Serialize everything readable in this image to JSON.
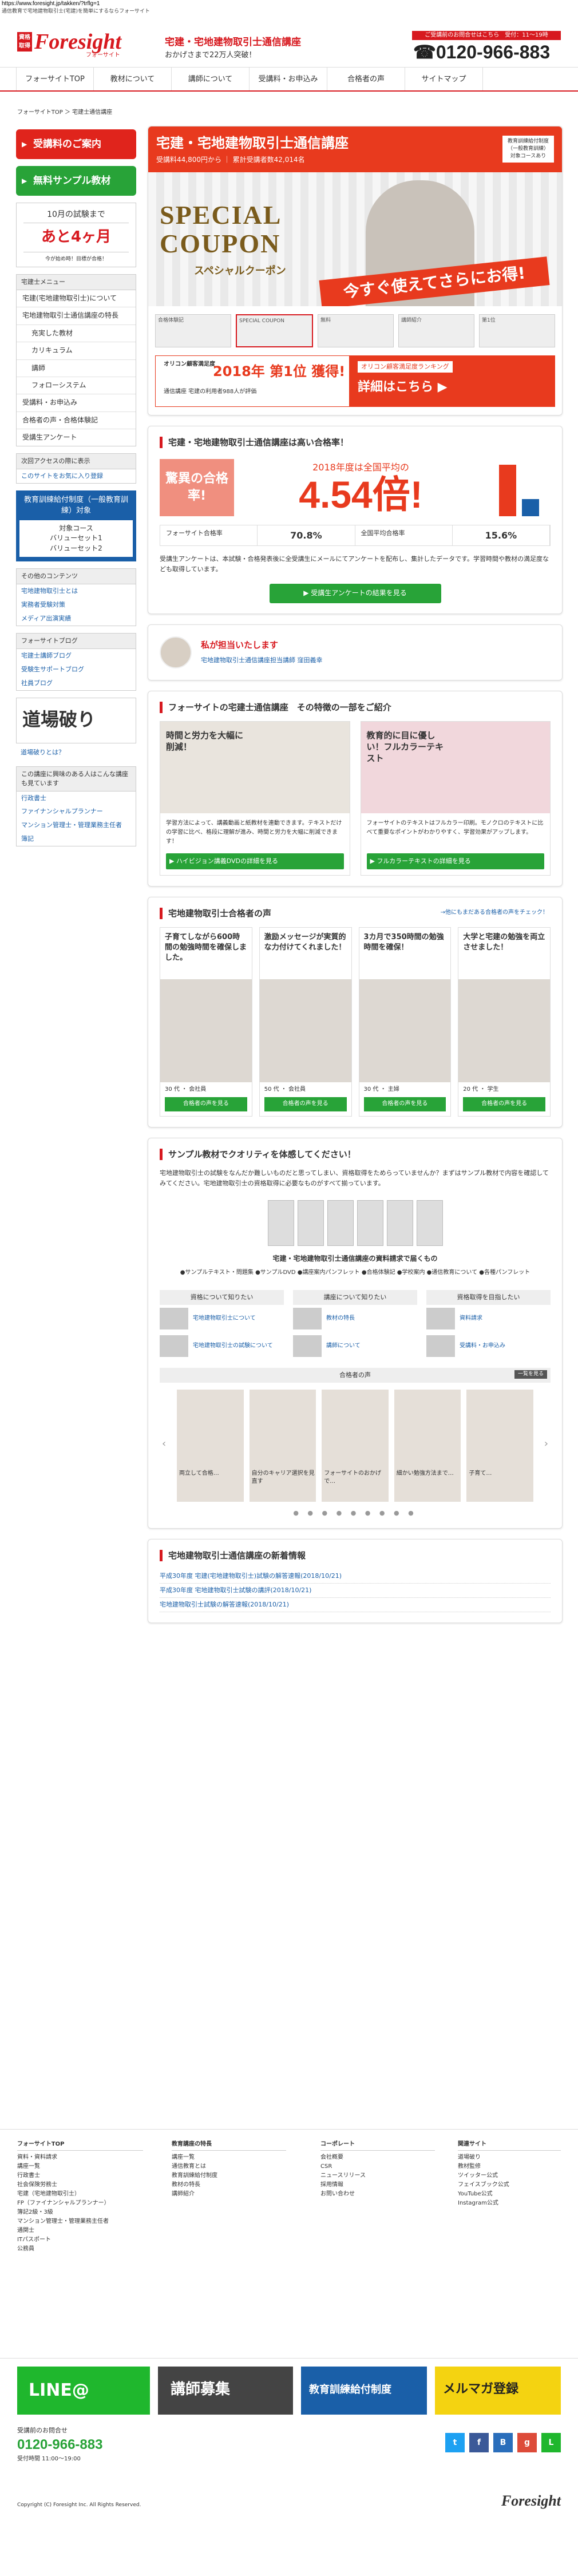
{
  "url": "https://www.foresight.jp/takken/?trflg=1",
  "tagline": "通信教育で宅地建物取引士(宅建)を簡単にするならフォーサイト",
  "header": {
    "badge": "資格取得",
    "logo": "Foresight",
    "logo_sub": "フォーサイト",
    "title": "宅建・宅地建物取引士通信講座",
    "subtitle": "おかげさまで22万人突破！",
    "tel_note": "ご受講前のお問合せはこちら　受付：11〜19時",
    "tel": "0120-966-883"
  },
  "nav": [
    "フォーサイトTOP",
    "教材について",
    "講師について",
    "受講料・お申込み",
    "合格者の声",
    "サイトマップ"
  ],
  "breadcrumb": "フォーサイトTOP ＞ 宅建士通信講座",
  "sidebar": {
    "cta1": "受講料のご案内",
    "cta2": "無料サンプル教材",
    "count1": "10月の試験まで",
    "count2": "あと4ヶ月",
    "count3": "今が始め時！目標が合格！",
    "menu_head": "宅建士メニュー",
    "menu": [
      "宅建(宅地建物取引士)について",
      "宅地建物取引士通信講座の特長",
      "充実した教材",
      "カリキュラム",
      "講師",
      "フォローシステム",
      "受講料・お申込み",
      "合格者の声・合格体験記",
      "受講生アンケート"
    ],
    "access_head": "次回アクセスの際に表示",
    "access_link": "このサイトをお気に入り登録",
    "kyouiku": "教育訓練給付制度（一般教育訓練）対象",
    "kyouiku_inner": "対象コース\nバリューセット1\nバリューセット2",
    "other_head": "その他のコンテンツ",
    "other": [
      "宅地建物取引士とは",
      "実務者受験対策",
      "メディア出演実績"
    ],
    "blog_head": "フォーサイトブログ",
    "blog": [
      "宅建士講師ブログ",
      "受験生サポートブログ",
      "社員ブログ"
    ],
    "dojo": "道場破り",
    "dojo_link": "道場破りとは？",
    "interest_head": "この講座に興味のある人はこんな講座も見ています",
    "interest": [
      "行政書士",
      "ファイナンシャルプランナー",
      "マンション管理士・管理業務主任者",
      "簿記"
    ]
  },
  "course": {
    "title": "宅建・宅地建物取引士通信講座",
    "stats": "受講料44,800円から ｜ 累計受講者数42,014名",
    "note": "教育訓練給付制度（一般教育訓練）対象コースあり"
  },
  "coupon": {
    "line1": "SPECIAL",
    "line2": "COUPON",
    "line3": "スペシャルクーポン",
    "ribbon": "今すぐ使えてさらにお得!"
  },
  "thumbs": [
    "合格体験記",
    "SPECIAL COUPON",
    "無料",
    "講師紹介",
    "第1位"
  ],
  "rank": {
    "l1": "オリコン顧客満足度",
    "l2": "2018年 第1位 獲得!",
    "l3": "通信講座 宅建の利用者988人が評価",
    "r1": "オリコン顧客満足度ランキング",
    "r2": "詳細はこちら ▶"
  },
  "pass": {
    "title": "宅建・宅地建物取引士通信講座は高い合格率！",
    "label": "驚異の合格率!",
    "year": "2018年度は全国平均の",
    "big": "4.54倍!",
    "f_label": "フォーサイト合格率",
    "f_val": "70.8%",
    "n_label": "全国平均合格率",
    "n_val": "15.6%",
    "text": "受講生アンケートは、本試験・合格発表後に全受講生にメールにてアンケートを配布し、集計したデータです。学習時間や教材の満足度なども取得しています。",
    "btn": "▶ 受講生アンケートの結果を見る"
  },
  "tantou": {
    "head": "私が担当いたします",
    "name": "宅地建物取引士通信講座担当講師 窪田義幸"
  },
  "features": {
    "title": "フォーサイトの宅建士通信講座　その特徴の一部をご紹介",
    "c1_title": "時間と労力を大幅に削減！",
    "c1_text": "学習方法によって、講義動画と紙教材を連動できます。テキストだけの学習に比べ、格段に理解が進み、時間と労力を大幅に削減できます！",
    "c1_btn": "▶ ハイビジョン講義DVDの詳細を見る",
    "c2_title": "教育的に目に優しい！フルカラーテキスト",
    "c2_text": "フォーサイトのテキストはフルカラー印刷。モノクロのテキストに比べて重要なポイントがわかりやすく、学習効果がアップします。",
    "c2_btn": "▶ フルカラーテキストの詳細を見る"
  },
  "voices": {
    "title": "宅地建物取引士合格者の声",
    "link": "→他にもまだある合格者の声をチェック！",
    "items": [
      {
        "q": "子育てしながら600時間の勉強時間を確保しました。",
        "m": "30 代 ・ 会社員",
        "g": "合格者の声を見る"
      },
      {
        "q": "激励メッセージが実質的な力付けてくれました！",
        "m": "50 代 ・ 会社員",
        "g": "合格者の声を見る"
      },
      {
        "q": "3カ月で350時間の勉強時間を確保！",
        "m": "30 代 ・ 主婦",
        "g": "合格者の声を見る"
      },
      {
        "q": "大学と宅建の勉強を両立させました！",
        "m": "20 代 ・ 学生",
        "g": "合格者の声を見る"
      }
    ]
  },
  "sample": {
    "title": "サンプル教材でクオリティを体感してください！",
    "text": "宅地建物取引士の試験をなんだか難しいものだと思ってしまい、資格取得をためらっていませんか？まずはサンプル教材で内容を確認してみてください。宅地建物取引士の資格取得に必要なものがすべて揃っています。",
    "caption": "宅建・宅地建物取引士通信講座の資料請求で届くもの",
    "list": "●サンプルテキスト・問題集 ●サンプルDVD ●講座案内パンフレット ●合格体験記 ●学校案内 ●通信教育について ●各種パンフレット",
    "cats": [
      {
        "h": "資格について知りたい",
        "i": [
          "宅地建物取引士について",
          "宅地建物取引士の試験について"
        ]
      },
      {
        "h": "講座について知りたい",
        "i": [
          "教材の特長",
          "講師について"
        ]
      },
      {
        "h": "資格取得を目指したい",
        "i": [
          "資料請求",
          "受講料・お申込み"
        ]
      }
    ],
    "strip_head": "合格者の声",
    "strip_all": "一覧を見る",
    "strip": [
      "両立して合格…",
      "自分のキャリア選択を見直す",
      "フォーサイトのおかげで…",
      "細かい勉強方法まで…",
      "子育て…"
    ]
  },
  "news": {
    "title": "宅地建物取引士通信講座の新着情報",
    "items": [
      "平成30年度 宅建(宅地建物取引士)試験の解答速報(2018/10/21)",
      "平成30年度 宅地建物取引士試験の講評(2018/10/21)",
      "宅地建物取引士試験の解答速報(2018/10/21)"
    ]
  },
  "fnav": {
    "c1_h": "フォーサイトTOP",
    "c1": [
      "資料・資料請求",
      "講座一覧",
      "行政書士",
      "社会保険労務士",
      "宅建（宅地建物取引士）",
      "FP（ファイナンシャルプランナー）",
      "簿記2級・3級",
      "マンション管理士・管理業務主任者",
      "通関士",
      "ITパスポート",
      "公務員"
    ],
    "c2_h": "教育講座の特長",
    "c2": [
      "講座一覧",
      "通信教育とは",
      "教育訓練給付制度",
      "教材の特長",
      "講師紹介"
    ],
    "c3_h": "コーポレート",
    "c3": [
      "会社概要",
      "CSR",
      "ニュースリリース",
      "採用情報",
      "お問い合わせ"
    ],
    "c4_h": "関連サイト",
    "c4": [
      "道場破り",
      "教材監修",
      "ツイッター公式",
      "フェイスブック公式",
      "YouTube公式",
      "Instagram公式"
    ]
  },
  "footer": {
    "banner1": "LINE@",
    "banner2": "講師募集",
    "banner3": "教育訓練給付制度",
    "banner4": "メルマガ登録",
    "tel_label": "受講前のお問合せ",
    "tel": "0120-966-883",
    "hours": "受付時間 11:00〜19:00",
    "copy": "Copyright (C) Foresight Inc. All Rights Reserved.",
    "logo": "Foresight"
  }
}
